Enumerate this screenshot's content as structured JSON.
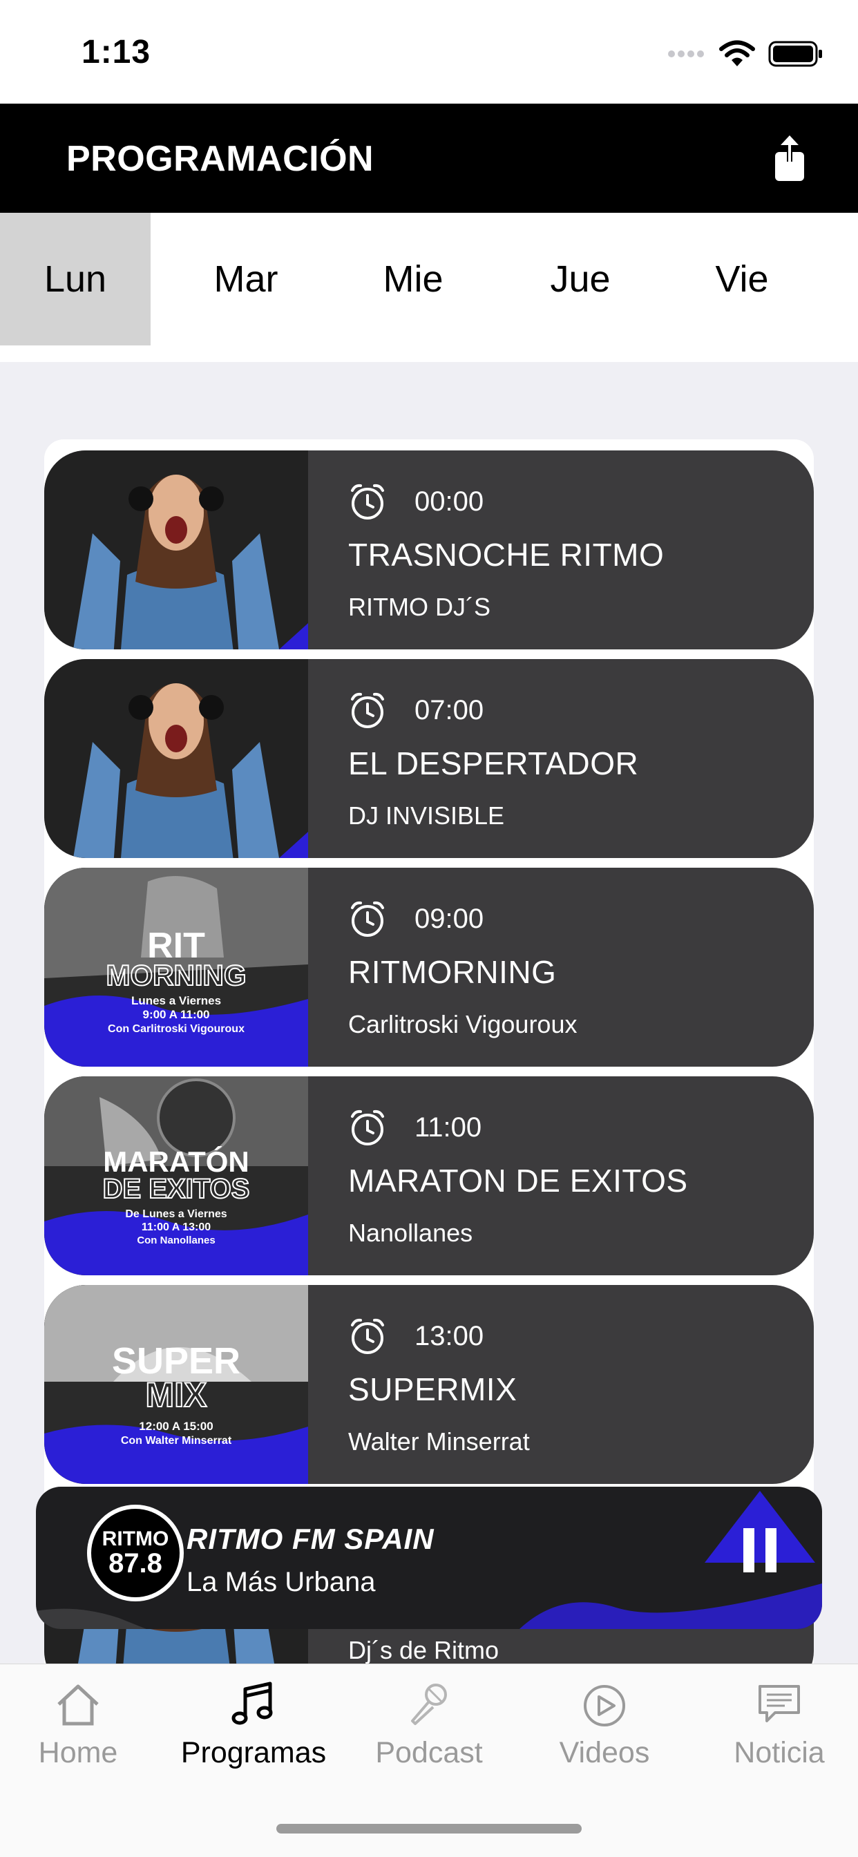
{
  "status_bar": {
    "time": "1:13"
  },
  "header": {
    "title": "PROGRAMACIÓN",
    "share_icon": "share-icon"
  },
  "days": [
    "Lun",
    "Mar",
    "Mie",
    "Jue",
    "Vie"
  ],
  "selected_day": "Lun",
  "programs": [
    {
      "time": "00:00",
      "title": "TRASNOCHE RITMO",
      "host": "RITMO DJ´S",
      "art": "woman-headphones"
    },
    {
      "time": "07:00",
      "title": "EL DESPERTADOR",
      "host": "DJ INVISIBLE",
      "art": "woman-headphones"
    },
    {
      "time": "09:00",
      "title": "RITMORNING",
      "host": "Carlitroski Vigouroux",
      "art": "ritmorning-poster",
      "poster": {
        "line1": "RIT",
        "line2": "MORNING",
        "sub1": "Lunes a Viernes",
        "sub2": "9:00 A 11:00",
        "sub3": "Con Carlitroski Vigouroux"
      }
    },
    {
      "time": "11:00",
      "title": "MARATON DE EXITOS",
      "host": "Nanollanes",
      "art": "maraton-poster",
      "poster": {
        "line1": "MARATÓN",
        "line2": "DE EXITOS",
        "sub1": "De Lunes a Viernes",
        "sub2": "11:00 A 13:00",
        "sub3": "Con Nanollanes"
      }
    },
    {
      "time": "13:00",
      "title": "SUPERMIX",
      "host": "Walter Minserrat",
      "art": "supermix-poster",
      "poster": {
        "line1": "SUPER",
        "line2": "MIX",
        "sub1": "12:00 A 15:00",
        "sub2": "Con Walter Minserrat",
        "sub3": ""
      }
    },
    {
      "time": "",
      "title": "",
      "host": "Dj´s de Ritmo",
      "art": "woman-headphones"
    }
  ],
  "player": {
    "station": "RITMO FM SPAIN",
    "slogan": "La Más Urbana",
    "logo_line1": "RITMO",
    "logo_line2": "87.8",
    "state": "playing",
    "accent": "#2b1fd6"
  },
  "tab_bar": [
    {
      "label": "Home",
      "icon": "home-icon",
      "active": false
    },
    {
      "label": "Programas",
      "icon": "music-note-icon",
      "active": true
    },
    {
      "label": "Podcast",
      "icon": "microphone-icon",
      "active": false
    },
    {
      "label": "Videos",
      "icon": "play-circle-icon",
      "active": false
    },
    {
      "label": "Noticia",
      "icon": "message-icon",
      "active": false
    }
  ],
  "colors": {
    "header_bg": "#000000",
    "row_bg": "#3c3b3d",
    "accent_blue": "#2b1fd6",
    "active_day_bg": "#d3d3d3"
  }
}
